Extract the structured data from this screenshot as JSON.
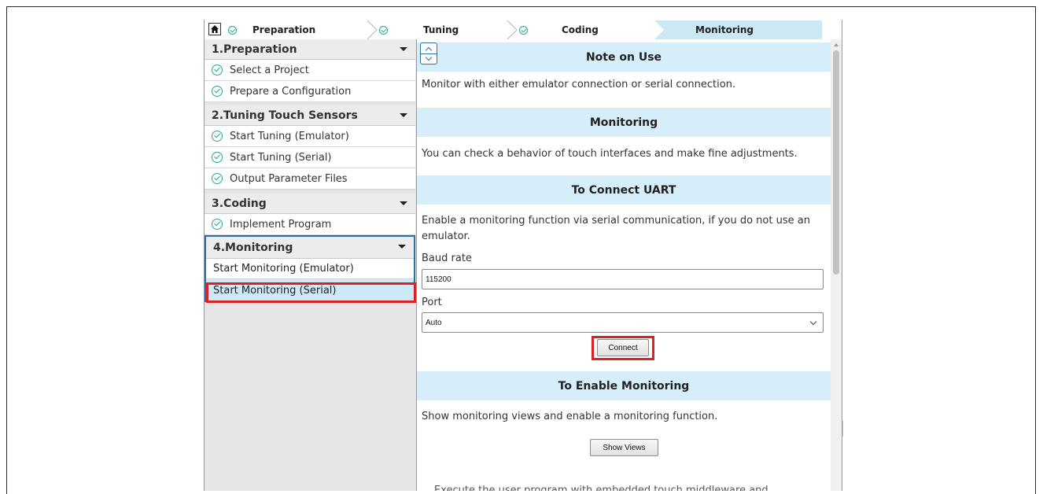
{
  "stepbar": {
    "home_icon": "home-icon",
    "steps": [
      {
        "label": "Preparation",
        "done": true
      },
      {
        "label": "Tuning",
        "done": true
      },
      {
        "label": "Coding",
        "done": true
      },
      {
        "label": "Monitoring",
        "active": true
      }
    ]
  },
  "sidebar": {
    "sections": [
      {
        "title": "1.Preparation",
        "items": [
          "Select a Project",
          "Prepare a Configuration"
        ]
      },
      {
        "title": "2.Tuning Touch Sensors",
        "items": [
          "Start Tuning (Emulator)",
          "Start Tuning (Serial)",
          "Output Parameter Files"
        ]
      },
      {
        "title": "3.Coding",
        "items": [
          "Implement Program"
        ]
      },
      {
        "title": "4.Monitoring",
        "items": [
          "Start Monitoring (Emulator)",
          "Start Monitoring (Serial)"
        ]
      }
    ]
  },
  "main": {
    "note_title": "Note on Use",
    "note_text": "Monitor with either emulator connection or serial connection.",
    "monitoring_title": "Monitoring",
    "monitoring_text": "You can check a behavior of touch interfaces and make fine adjustments.",
    "uart_title": "To Connect UART",
    "uart_text": "Enable a monitoring function via serial communication, if you do not use an emulator.",
    "baud_label": "Baud rate",
    "baud_value": "115200",
    "port_label": "Port",
    "port_value": "Auto",
    "connect_label": "Connect",
    "enable_title": "To Enable Monitoring",
    "enable_text": "Show monitoring views and enable a monitoring function.",
    "show_views_label": "Show Views",
    "execute_text": "Execute the user program with embedded touch middleware and"
  },
  "colors": {
    "accent_blue": "#d6eef9",
    "selected_item": "#cde8f6",
    "check_teal": "#26a49a",
    "highlight_red": "#e02020",
    "group_border": "#2f6fa0"
  }
}
